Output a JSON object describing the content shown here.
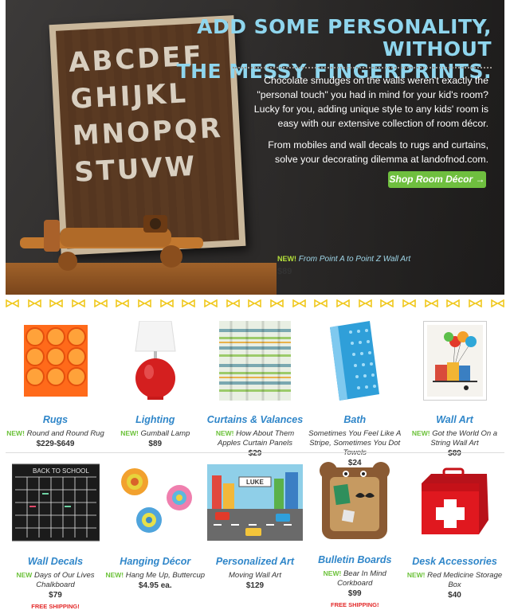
{
  "hero": {
    "headline_line1": "ADD SOME PERSONALITY, WITHOUT",
    "headline_line2": "THE MESSY FINGERPRINTS.",
    "paragraph1": "Chocolate smudges on the walls weren't exactly the \"personal touch\" you had in mind for your kid's room? Lucky for you, adding unique style to any kids' room is easy with our extensive collection of room décor.",
    "paragraph2": "From mobiles and wall decals to rugs and curtains, solve your decorating dilemma at landofnod.com.",
    "button_label": "Shop Room Décor →",
    "caption_new": "NEW!",
    "caption_name": "From Point A to Point Z Wall Art",
    "caption_price": "$89",
    "artwork_letters": [
      "ABCDEF",
      "GHIJKL",
      "MNOPQR",
      "STUVW"
    ],
    "colors": {
      "headline": "#8fd6ee",
      "button": "#6fbf3f",
      "new": "#b6e23b"
    }
  },
  "products_row1": [
    {
      "category": "Rugs",
      "new": "NEW!",
      "desc": "Round and Round Rug",
      "price": "$229-$649",
      "icon": "orange-circle-rug"
    },
    {
      "category": "Lighting",
      "new": "NEW!",
      "desc": "Gumball Lamp",
      "price": "$89",
      "icon": "red-lamp"
    },
    {
      "category": "Curtains & Valances",
      "new": "NEW!",
      "desc": "How About Them Apples Curtain Panels",
      "price": "$29",
      "icon": "striped-curtain"
    },
    {
      "category": "Bath",
      "new": "",
      "desc": "Sometimes You Feel Like A Stripe, Sometimes You Dot Towels",
      "price": "$24",
      "icon": "dotted-towel"
    },
    {
      "category": "Wall Art",
      "new": "NEW!",
      "desc": "Got the World On a String Wall Art",
      "price": "$89",
      "icon": "balloon-house-print"
    }
  ],
  "products_row2": [
    {
      "category": "Wall Decals",
      "new": "NEW",
      "desc": "Days of Our Lives Chalkboard",
      "price": "$79",
      "free": "FREE SHIPPING!",
      "icon": "chalkboard-calendar",
      "chalk_title": "BACK TO SCHOOL"
    },
    {
      "category": "Hanging Décor",
      "new": "NEW!",
      "desc": "Hang Me Up, Buttercup",
      "price": "$4.95 ea.",
      "free": "",
      "icon": "flower-hooks"
    },
    {
      "category": "Personalized Art",
      "new": "",
      "desc": "Moving Wall Art",
      "price": "$129",
      "free": "",
      "icon": "city-traffic-art",
      "sign_text": "LUKE"
    },
    {
      "category": "Bulletin Boards",
      "new": "NEW!",
      "desc": "Bear In Mind Corkboard",
      "price": "$99",
      "free": "FREE SHIPPING!",
      "icon": "bear-corkboard"
    },
    {
      "category": "Desk Accessories",
      "new": "NEW!",
      "desc": "Red Medicine Storage Box",
      "price": "$40",
      "free": "",
      "icon": "red-medicine-box"
    }
  ],
  "link_color": "#2f86c9",
  "bow_color": "#f0c81e"
}
